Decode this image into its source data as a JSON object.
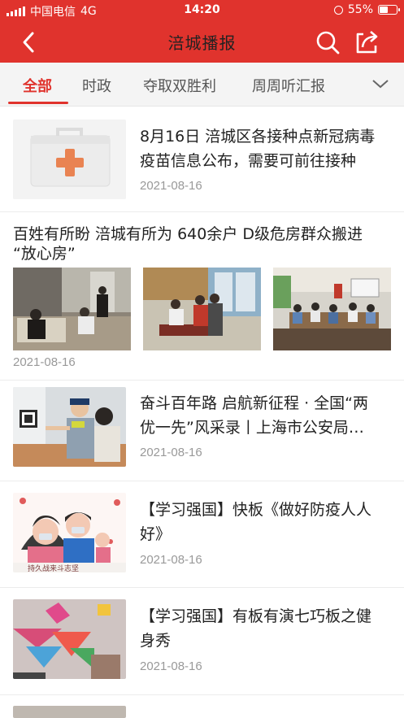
{
  "status": {
    "carrier": "中国电信",
    "network": "4G",
    "time": "14:20",
    "battery": "55%",
    "battery_level": 0.55
  },
  "nav": {
    "title": "涪城播报",
    "back_icon": "back-arrow-icon",
    "search_icon": "search-icon",
    "share_icon": "share-icon"
  },
  "tabs": [
    {
      "label": "全部",
      "active": true
    },
    {
      "label": "时政",
      "active": false
    },
    {
      "label": "夺取双胜利",
      "active": false
    },
    {
      "label": "周周听汇报",
      "active": false
    }
  ],
  "feed": [
    {
      "title_line1": "8月16日 涪城区各接种点新冠病毒",
      "title_line2": "疫苗信息公布，需要可前往接种",
      "date": "2021-08-16",
      "thumb_icon": "first-aid-kit-icon"
    },
    {
      "title_line1": "百姓有所盼 涪城有所为 640余户 D级危房群众搬进",
      "title_line2": "“放心房”",
      "date": "2021-08-16",
      "images": [
        "room-visit-photo",
        "family-home-photo",
        "meeting-room-photo"
      ]
    },
    {
      "title_line1": "奋斗百年路 启航新征程 · 全国“两",
      "title_line2": "优一先”风采录丨上海市公安局…",
      "date": "2021-08-16"
    },
    {
      "title_line1": "【学习强国】快板《做好防疫人人",
      "title_line2": "好》",
      "date": "2021-08-16",
      "thumb_caption": "持久战来斗志坚"
    },
    {
      "title_line1": "【学习强国】有板有演七巧板之健",
      "title_line2": "身秀",
      "date": "2021-08-16"
    }
  ]
}
